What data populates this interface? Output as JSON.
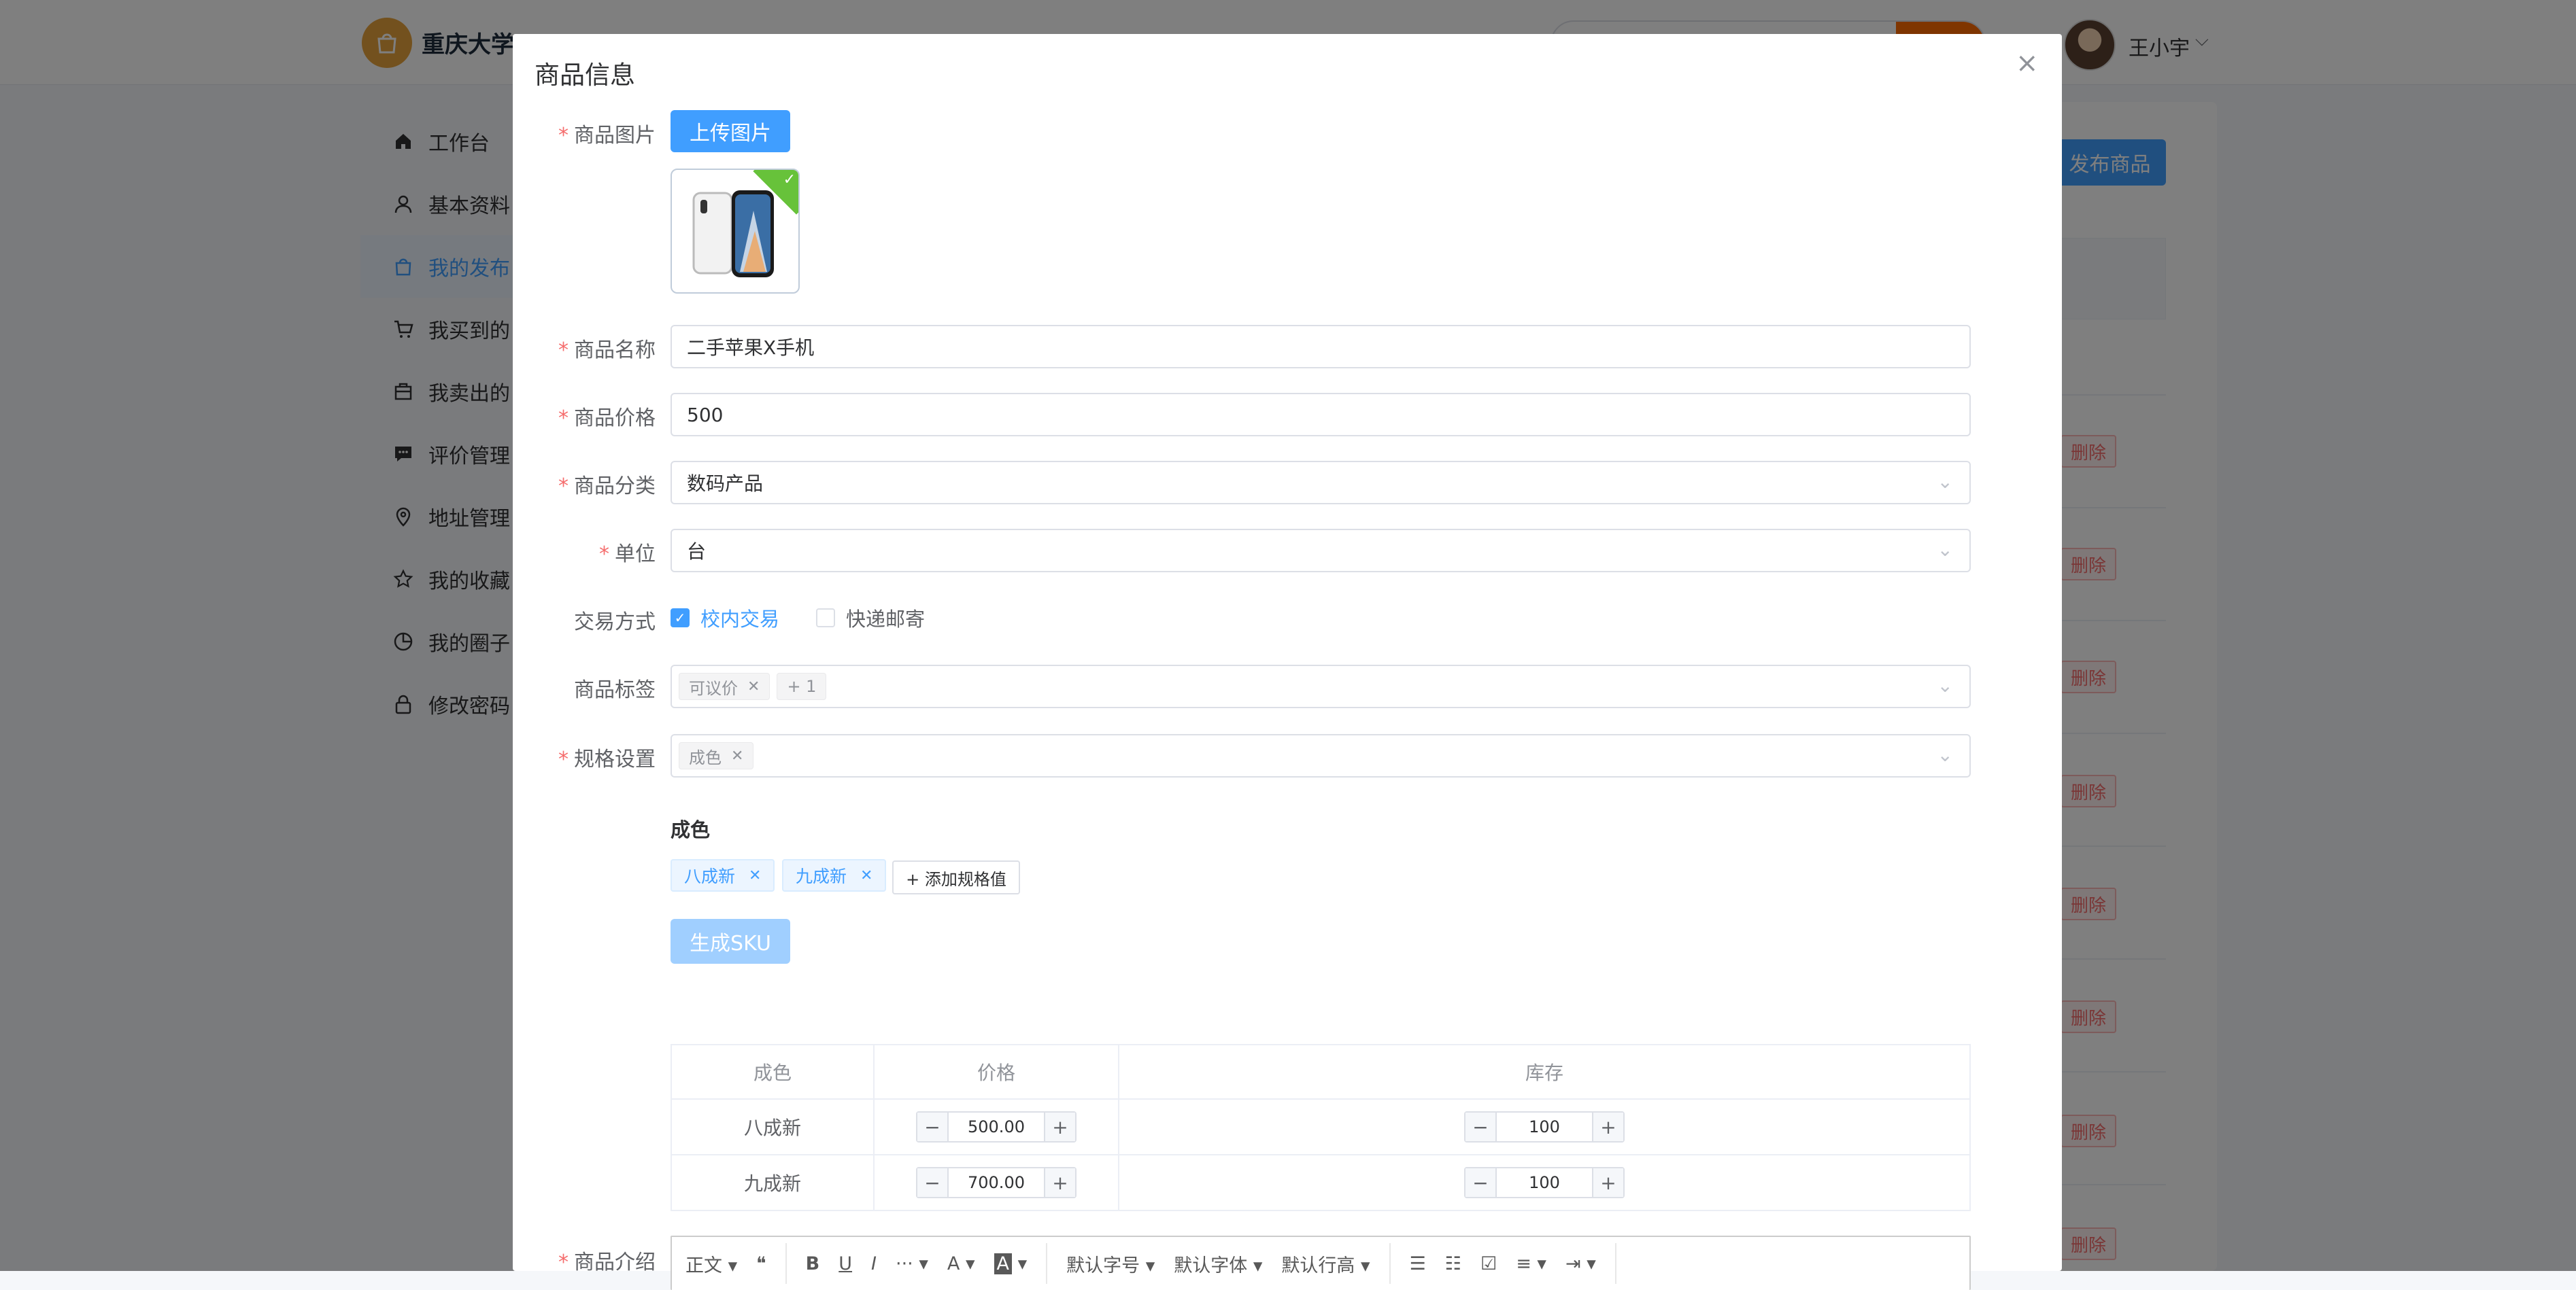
{
  "header": {
    "brand": "重庆大学",
    "user_name": "王小宇",
    "user_caret": "⌵"
  },
  "sidebar": {
    "items": [
      {
        "label": "工作台",
        "icon": "home-icon"
      },
      {
        "label": "基本资料",
        "icon": "user-icon"
      },
      {
        "label": "我的发布",
        "icon": "bag-icon",
        "active": true
      },
      {
        "label": "我买到的",
        "icon": "cart-icon"
      },
      {
        "label": "我卖出的",
        "icon": "box-icon"
      },
      {
        "label": "评价管理",
        "icon": "comment-icon"
      },
      {
        "label": "地址管理",
        "icon": "location-icon"
      },
      {
        "label": "我的收藏",
        "icon": "star-icon"
      },
      {
        "label": "我的圈子",
        "icon": "pie-icon"
      },
      {
        "label": "修改密码",
        "icon": "lock-icon"
      }
    ]
  },
  "main": {
    "publish_button": "发布商品",
    "delete_label": "删除"
  },
  "dialog": {
    "title": "商品信息",
    "close": "×",
    "image": {
      "label": "商品图片",
      "upload_button": "上传图片",
      "check": "✓"
    },
    "name": {
      "label": "商品名称",
      "value": "二手苹果X手机"
    },
    "price": {
      "label": "商品价格",
      "value": "500"
    },
    "category": {
      "label": "商品分类",
      "value": "数码产品"
    },
    "unit": {
      "label": "单位",
      "value": "台"
    },
    "trade": {
      "label": "交易方式",
      "options": [
        {
          "label": "校内交易",
          "checked": true
        },
        {
          "label": "快递邮寄",
          "checked": false
        }
      ]
    },
    "tags": {
      "label": "商品标签",
      "tag1": "可议价",
      "more": "+ 1"
    },
    "spec": {
      "label": "规格设置",
      "tag1": "成色"
    },
    "spec_group": {
      "title": "成色",
      "values": [
        "八成新",
        "九成新"
      ],
      "add_button": "+ 添加规格值",
      "generate_button": "生成SKU"
    },
    "sku_table": {
      "headers": [
        "成色",
        "价格",
        "库存"
      ],
      "rows": [
        {
          "spec": "八成新",
          "price": "500.00",
          "stock": "100"
        },
        {
          "spec": "九成新",
          "price": "700.00",
          "stock": "100"
        }
      ]
    },
    "intro": {
      "label": "商品介绍",
      "toolbar": {
        "heading": "正文",
        "quote": "❝",
        "bold": "B",
        "underline": "U",
        "italic": "I",
        "more": "···",
        "font_color": "A",
        "bg_color": "A",
        "font_size": "默认字号",
        "font_family": "默认字体",
        "line_height": "默认行高"
      }
    },
    "required_mark": "*",
    "caret": "⌄"
  },
  "colors": {
    "primary": "#409eff",
    "danger": "#f56c6c",
    "success": "#67c23a",
    "brand_orange": "#ff6a00"
  }
}
